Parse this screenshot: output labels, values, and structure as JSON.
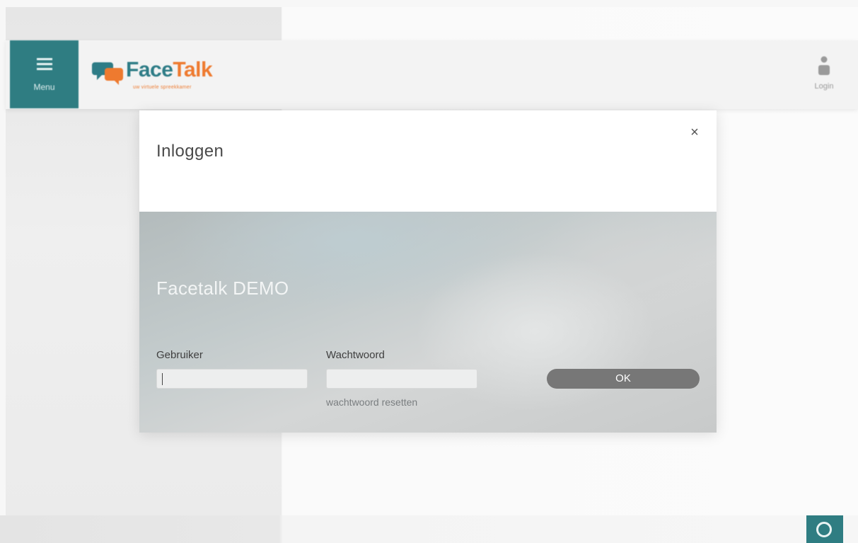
{
  "header": {
    "menu_label": "Menu",
    "logo": {
      "name_part1": "Face",
      "name_part2": "Talk",
      "tagline": "uw virtuele spreekkamer"
    },
    "login_label": "Login"
  },
  "modal": {
    "title": "Inloggen",
    "close_label": "×",
    "subtitle": "Facetalk DEMO",
    "username_label": "Gebruiker",
    "username_value": "",
    "password_label": "Wachtwoord",
    "password_value": "",
    "reset_link": "wachtwoord resetten",
    "ok_label": "OK"
  },
  "colors": {
    "brand_teal": "#2f7d82",
    "brand_orange": "#ee7a2f",
    "ok_button": "#777777"
  },
  "icons": {
    "menu": "hamburger-icon",
    "logo": "speech-bubbles-icon",
    "login": "user-icon",
    "chat": "chat-ring-icon"
  }
}
